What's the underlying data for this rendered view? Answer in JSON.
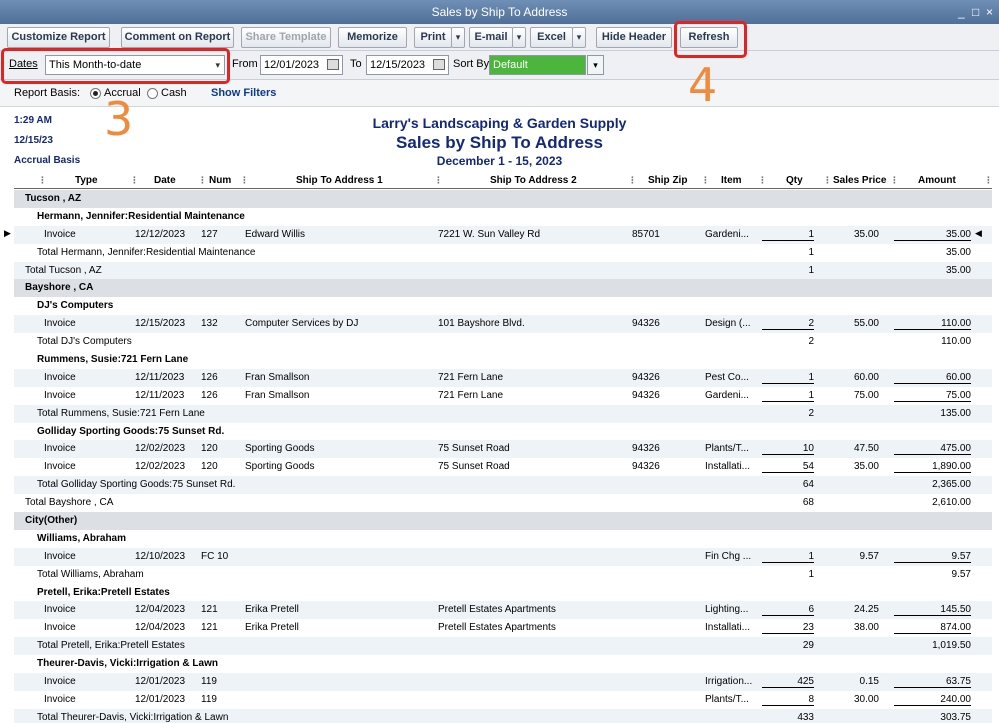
{
  "window": {
    "title": "Sales by Ship To Address",
    "controls": [
      "_",
      "□",
      "×"
    ]
  },
  "toolbar": {
    "customize": "Customize Report",
    "comment": "Comment on Report",
    "share": "Share Template",
    "memorize": "Memorize",
    "print": "Print",
    "email": "E-mail",
    "excel": "Excel",
    "hide_header": "Hide Header",
    "refresh": "Refresh",
    "arrow": "▾"
  },
  "filters": {
    "dates_label": "Dates",
    "dates_value": "This Month-to-date",
    "from_label": "From",
    "from_value": "12/01/2023",
    "to_label": "To",
    "to_value": "12/15/2023",
    "sort_label": "Sort By",
    "sort_value": "Default"
  },
  "basis": {
    "label": "Report Basis:",
    "accrual": "Accrual",
    "cash": "Cash",
    "selected": "accrual",
    "show_filters": "Show Filters"
  },
  "annotations": {
    "step3": "3",
    "step4": "4"
  },
  "report": {
    "time": "1:29 AM",
    "date": "12/15/23",
    "basis": "Accrual Basis",
    "company": "Larry's Landscaping & Garden Supply",
    "title": "Sales by Ship To Address",
    "period": "December 1 - 15, 2023"
  },
  "columns": [
    "Type",
    "Date",
    "Num",
    "Ship To Address 1",
    "Ship To Address 2",
    "Ship Zip",
    "Item",
    "Qty",
    "Sales Price",
    "Amount"
  ],
  "rows": [
    {
      "kind": "group",
      "label": "Tucson , AZ"
    },
    {
      "kind": "sub",
      "label": "Hermann, Jennifer:Residential Maintenance"
    },
    {
      "kind": "line",
      "type": "Invoice",
      "date": "12/12/2023",
      "num": "127",
      "addr1": "Edward Willis",
      "addr2": "7221 W. Sun Valley Rd",
      "zip": "85701",
      "item": "Gardeni...",
      "qty": "1",
      "price": "35.00",
      "amount": "35.00",
      "marked": true
    },
    {
      "kind": "total2",
      "label": "Total Hermann, Jennifer:Residential Maintenance",
      "qty": "1",
      "amount": "35.00"
    },
    {
      "kind": "total1",
      "label": "Total Tucson , AZ",
      "qty": "1",
      "amount": "35.00"
    },
    {
      "kind": "group",
      "label": "Bayshore , CA"
    },
    {
      "kind": "sub",
      "label": "DJ's Computers"
    },
    {
      "kind": "line",
      "type": "Invoice",
      "date": "12/15/2023",
      "num": "132",
      "addr1": "Computer Services by DJ",
      "addr2": "101 Bayshore Blvd.",
      "zip": "94326",
      "item": "Design (...",
      "qty": "2",
      "price": "55.00",
      "amount": "110.00"
    },
    {
      "kind": "total2",
      "label": "Total DJ's Computers",
      "qty": "2",
      "amount": "110.00"
    },
    {
      "kind": "sub",
      "label": "Rummens, Susie:721 Fern Lane"
    },
    {
      "kind": "line",
      "type": "Invoice",
      "date": "12/11/2023",
      "num": "126",
      "addr1": "Fran Smallson",
      "addr2": "721 Fern Lane",
      "zip": "94326",
      "item": "Pest Co...",
      "qty": "1",
      "price": "60.00",
      "amount": "60.00"
    },
    {
      "kind": "line",
      "type": "Invoice",
      "date": "12/11/2023",
      "num": "126",
      "addr1": "Fran Smallson",
      "addr2": "721 Fern Lane",
      "zip": "94326",
      "item": "Gardeni...",
      "qty": "1",
      "price": "75.00",
      "amount": "75.00"
    },
    {
      "kind": "total2",
      "label": "Total Rummens, Susie:721 Fern Lane",
      "qty": "2",
      "amount": "135.00"
    },
    {
      "kind": "sub",
      "label": "Golliday Sporting Goods:75 Sunset Rd."
    },
    {
      "kind": "line",
      "type": "Invoice",
      "date": "12/02/2023",
      "num": "120",
      "addr1": "Sporting Goods",
      "addr2": "75 Sunset Road",
      "zip": "94326",
      "item": "Plants/T...",
      "qty": "10",
      "price": "47.50",
      "amount": "475.00"
    },
    {
      "kind": "line",
      "type": "Invoice",
      "date": "12/02/2023",
      "num": "120",
      "addr1": "Sporting Goods",
      "addr2": "75 Sunset Road",
      "zip": "94326",
      "item": "Installati...",
      "qty": "54",
      "price": "35.00",
      "amount": "1,890.00"
    },
    {
      "kind": "total2",
      "label": "Total Golliday Sporting Goods:75 Sunset Rd.",
      "qty": "64",
      "amount": "2,365.00"
    },
    {
      "kind": "total1",
      "label": "Total Bayshore , CA",
      "qty": "68",
      "amount": "2,610.00"
    },
    {
      "kind": "group",
      "label": "City(Other)"
    },
    {
      "kind": "sub",
      "label": "Williams, Abraham"
    },
    {
      "kind": "line",
      "type": "Invoice",
      "date": "12/10/2023",
      "num": "FC 10",
      "addr1": "",
      "addr2": "",
      "zip": "",
      "item": "Fin Chg ...",
      "qty": "1",
      "price": "9.57",
      "amount": "9.57"
    },
    {
      "kind": "total2",
      "label": "Total Williams, Abraham",
      "qty": "1",
      "amount": "9.57"
    },
    {
      "kind": "sub",
      "label": "Pretell, Erika:Pretell Estates"
    },
    {
      "kind": "line",
      "type": "Invoice",
      "date": "12/04/2023",
      "num": "121",
      "addr1": "Erika Pretell",
      "addr2": "Pretell Estates Apartments",
      "zip": "",
      "item": "Lighting...",
      "qty": "6",
      "price": "24.25",
      "amount": "145.50"
    },
    {
      "kind": "line",
      "type": "Invoice",
      "date": "12/04/2023",
      "num": "121",
      "addr1": "Erika Pretell",
      "addr2": "Pretell Estates Apartments",
      "zip": "",
      "item": "Installati...",
      "qty": "23",
      "price": "38.00",
      "amount": "874.00"
    },
    {
      "kind": "total2",
      "label": "Total Pretell, Erika:Pretell Estates",
      "qty": "29",
      "amount": "1,019.50"
    },
    {
      "kind": "sub",
      "label": "Theurer-Davis, Vicki:Irrigation & Lawn"
    },
    {
      "kind": "line",
      "type": "Invoice",
      "date": "12/01/2023",
      "num": "119",
      "addr1": "",
      "addr2": "",
      "zip": "",
      "item": "Irrigation...",
      "qty": "425",
      "price": "0.15",
      "amount": "63.75"
    },
    {
      "kind": "line",
      "type": "Invoice",
      "date": "12/01/2023",
      "num": "119",
      "addr1": "",
      "addr2": "",
      "zip": "",
      "item": "Plants/T...",
      "qty": "8",
      "price": "30.00",
      "amount": "240.00"
    },
    {
      "kind": "total2",
      "label": "Total Theurer-Davis, Vicki:Irrigation & Lawn",
      "qty": "433",
      "amount": "303.75"
    }
  ]
}
